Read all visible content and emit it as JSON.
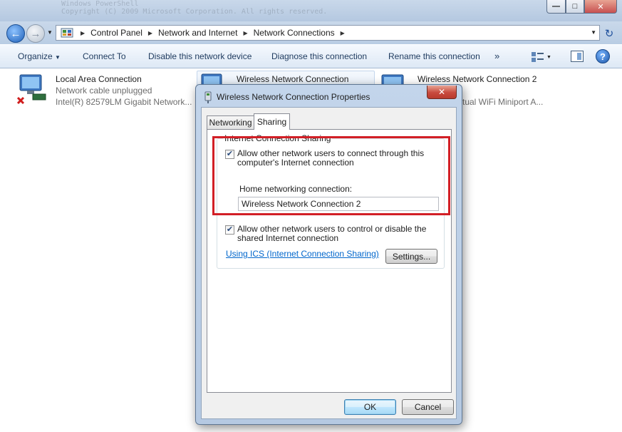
{
  "console_ghost": [
    "Windows PowerShell",
    "Copyright (C) 2009 Microsoft Corporation. All rights reserved."
  ],
  "window_controls": {
    "minimize": "—",
    "maximize": "□",
    "close": "✕"
  },
  "address_bar": {
    "breadcrumbs": [
      "Control Panel",
      "Network and Internet",
      "Network Connections"
    ]
  },
  "commands": {
    "organize": "Organize",
    "connect_to": "Connect To",
    "disable": "Disable this network device",
    "diagnose": "Diagnose this connection",
    "rename": "Rename this connection",
    "more": "»",
    "help": "?"
  },
  "connections": [
    {
      "name": "Local Area Connection",
      "status": "Network cable unplugged",
      "adapter": "Intel(R) 82579LM Gigabit Network...",
      "icon": "wired-network-disconnected-icon"
    },
    {
      "name": "Wireless Network Connection",
      "icon": "wireless-network-icon"
    },
    {
      "name": "Wireless Network Connection 2",
      "adapter": "rtual WiFi Miniport A...",
      "icon": "wireless-network-icon"
    }
  ],
  "dialog": {
    "title": "Wireless Network Connection Properties",
    "close": "✕",
    "tabs": [
      "Networking",
      "Sharing"
    ],
    "active_tab": "Sharing",
    "group_title": "Internet Connection Sharing",
    "allow_connect": {
      "checked": true,
      "label": "Allow other network users to connect through this computer's Internet connection"
    },
    "home_label": "Home networking connection:",
    "home_value": "Wireless Network Connection 2",
    "allow_control": {
      "checked": true,
      "label": "Allow other network users to control or disable the shared Internet connection"
    },
    "ics_link": "Using ICS (Internet Connection Sharing)",
    "settings_button": "Settings...",
    "ok_button": "OK",
    "cancel_button": "Cancel"
  },
  "colors": {
    "highlight": "#d21f26",
    "link": "#0066cc",
    "accent": "#1d5fb8"
  }
}
